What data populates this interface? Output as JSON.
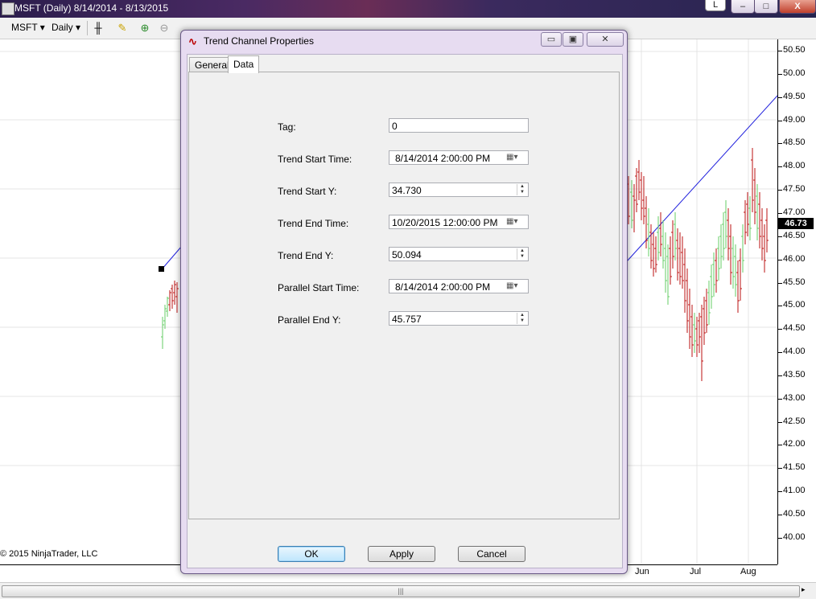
{
  "window": {
    "title": "MSFT (Daily)  8/14/2014 - 8/13/2015",
    "l_button": "L",
    "min_glyph": "–",
    "max_glyph": "□",
    "close_glyph": "X"
  },
  "toolbar": {
    "instrument": "MSFT",
    "interval": "Daily",
    "dropdown_glyph": "▾"
  },
  "chart": {
    "y_labels": [
      "50.50",
      "50.00",
      "49.50",
      "49.00",
      "48.50",
      "48.00",
      "47.50",
      "47.00",
      "46.50",
      "46.00",
      "45.50",
      "45.00",
      "44.50",
      "44.00",
      "43.50",
      "43.00",
      "42.50",
      "42.00",
      "41.50",
      "41.00",
      "40.50",
      "40.00"
    ],
    "last_price": "46.73",
    "x_labels": [
      "Jun",
      "Jul",
      "Aug"
    ],
    "copyright": "© 2015 NinjaTrader, LLC",
    "scroll_grip": "|||",
    "scroll_right": "▸",
    "colors": {
      "up": "#66cc66",
      "down": "#bb1111",
      "trendline": "#2020dd"
    }
  },
  "dialog": {
    "title": "Trend Channel Properties",
    "min_glyph": "▭",
    "max_glyph": "▣",
    "close_glyph": "✕",
    "tabs": {
      "general": "General",
      "data": "Data"
    },
    "fields": {
      "tag": {
        "label": "Tag:",
        "value": "0"
      },
      "trend_start_time": {
        "label": "Trend Start Time:",
        "value": "8/14/2014   2:00:00 PM"
      },
      "trend_start_y": {
        "label": "Trend Start Y:",
        "value": "34.730"
      },
      "trend_end_time": {
        "label": "Trend End Time:",
        "value": "10/20/2015 12:00:00 PM"
      },
      "trend_end_y": {
        "label": "Trend End Y:",
        "value": "50.094"
      },
      "parallel_start_time": {
        "label": "Parallel Start Time:",
        "value": "8/14/2014   2:00:00 PM"
      },
      "parallel_end_y": {
        "label": "Parallel End Y:",
        "value": "45.757"
      }
    },
    "calendar_glyph": "▦▾",
    "spin_glyph_up": "▲",
    "spin_glyph_down": "▼",
    "buttons": {
      "ok": "OK",
      "apply": "Apply",
      "cancel": "Cancel"
    }
  }
}
